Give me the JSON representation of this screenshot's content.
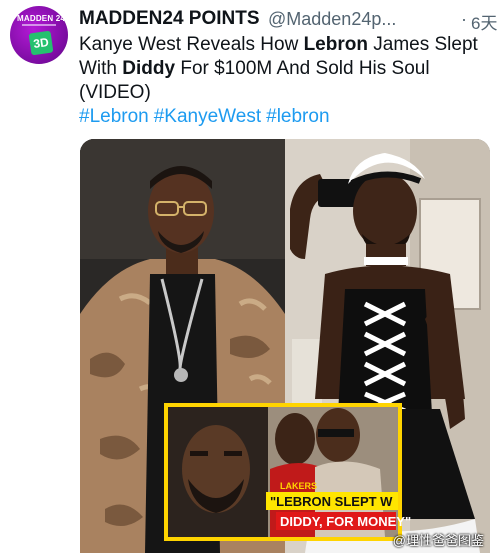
{
  "account": {
    "display_name": "MADDEN24 POINTS",
    "handle": "@Madden24p...",
    "dot": "·",
    "time": "6天",
    "avatar_text": "MADDEN 24",
    "avatar_logo": "3D"
  },
  "tweet": {
    "text_parts": [
      "Kanye West Reveals How ",
      "Lebron",
      " James Slept With ",
      "Diddy",
      " For $100M And Sold His Soul (VIDEO)"
    ],
    "hashtags": [
      "#Lebron",
      "#KanyeWest",
      "#lebron"
    ]
  },
  "media": {
    "caption_line1": "\"LEBRON SLEPT W",
    "caption_line2": "DIDDY, FOR MONEY\"",
    "jersey_text": "LAKERS",
    "watermark": "@理性爸爸图鉴"
  },
  "colors": {
    "link": "#1d9bf0",
    "caption_bg": "#ffe500",
    "caption_line2_bg": "#e01818",
    "thumb_border": "#ffd400"
  }
}
